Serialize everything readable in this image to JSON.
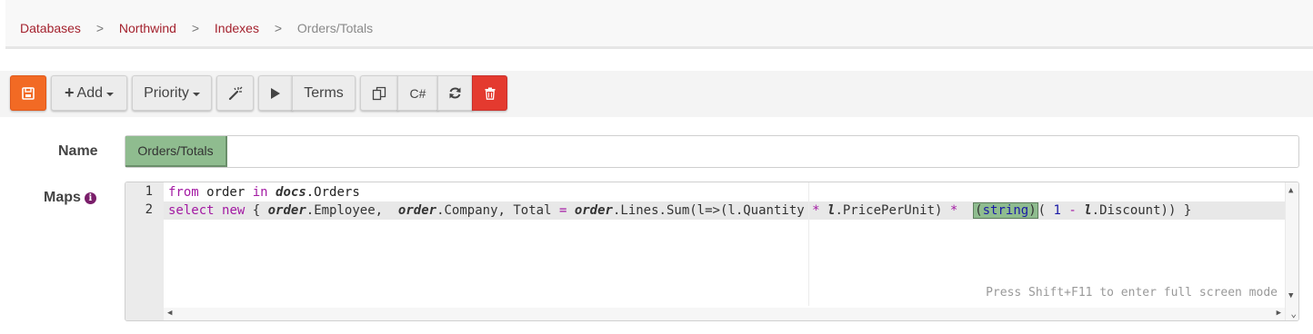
{
  "breadcrumb": {
    "items": [
      "Databases",
      "Northwind",
      "Indexes"
    ],
    "current": "Orders/Totals",
    "separator": ">"
  },
  "toolbar": {
    "save_icon": "save-icon",
    "add_label": "Add",
    "priority_label": "Priority",
    "format_icon": "magic-wand-icon",
    "run_icon": "play-icon",
    "terms_label": "Terms",
    "copy_icon": "copy-icon",
    "csharp_label": "C#",
    "refresh_icon": "refresh-icon",
    "delete_icon": "trash-icon",
    "save_color": "#f26a24",
    "delete_color": "#e43a2f"
  },
  "form": {
    "name_label": "Name",
    "name_value": "Orders/Totals",
    "maps_label": "Maps",
    "maps_info_icon": "info-icon"
  },
  "editor": {
    "line_numbers": [
      "1",
      "2"
    ],
    "hint": "Press Shift+F11 to enter full screen mode",
    "line1": {
      "kw_from": "from",
      "t1": " order ",
      "kw_in": "in",
      "sp": " ",
      "docs": "docs",
      "orders": ".Orders"
    },
    "line2": {
      "kw_select": "select",
      "sp1": " ",
      "kw_new": "new",
      "t1": " { ",
      "order1": "order",
      "t2": ".Employee,  ",
      "order2": "order",
      "t3": ".Company, Total ",
      "eq": "=",
      "sp2": " ",
      "order3": "order",
      "t4": ".Lines.Sum(l=>(l.Quantity ",
      "star1": "*",
      "sp3": " ",
      "l1": "l",
      "t5": ".PricePerUnit) ",
      "star2": "*",
      "t6": "  ",
      "paren_open": "(",
      "string_kw": "string",
      "paren_close": ")",
      "t7": "( ",
      "one": "1",
      "sp4": " ",
      "minus": "-",
      "sp5": " ",
      "l2": "l",
      "t8": ".Discount)) }"
    }
  }
}
